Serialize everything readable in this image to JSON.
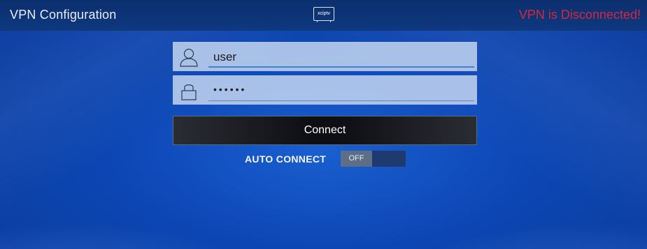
{
  "header": {
    "title": "VPN Configuration",
    "logo_text": "xciptv",
    "status": "VPN is Disconnected!"
  },
  "form": {
    "username": {
      "value": "user",
      "icon": "user-icon"
    },
    "password": {
      "value": "••••••",
      "icon": "lock-icon"
    },
    "connect_label": "Connect",
    "auto_connect": {
      "label": "AUTO CONNECT",
      "state": "OFF"
    }
  },
  "colors": {
    "status": "#d8263a",
    "header_bg": "#0e3880",
    "field_bg": "#bed2ee",
    "toggle_thumb": "#5c6f86"
  }
}
